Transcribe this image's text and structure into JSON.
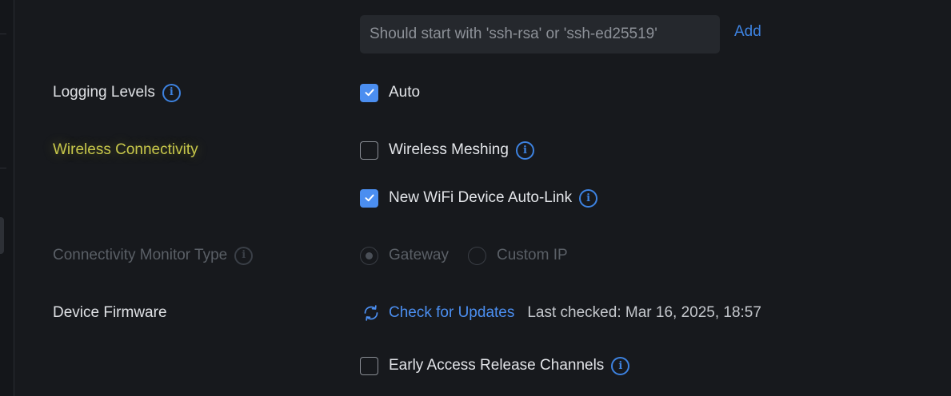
{
  "ssh_key": {
    "placeholder": "Should start with 'ssh-rsa' or 'ssh-ed25519'",
    "value": "",
    "add_label": "Add"
  },
  "logging": {
    "label": "Logging Levels",
    "auto_label": "Auto",
    "auto_checked": true
  },
  "wireless": {
    "label": "Wireless Connectivity",
    "meshing_label": "Wireless Meshing",
    "meshing_checked": false,
    "autolink_label": "New WiFi Device Auto-Link",
    "autolink_checked": true
  },
  "connectivity_monitor": {
    "label": "Connectivity Monitor Type",
    "options": [
      "Gateway",
      "Custom IP"
    ],
    "selected": "Gateway",
    "disabled": true
  },
  "firmware": {
    "label": "Device Firmware",
    "check_label": "Check for Updates",
    "last_checked": "Last checked: Mar 16, 2025, 18:57",
    "early_access_label": "Early Access Release Channels",
    "early_access_checked": false
  },
  "colors": {
    "accent": "#4b8ef0",
    "highlight": "#c7c74a",
    "background": "#17191d"
  },
  "icons": {
    "info": "info-icon",
    "check": "check-icon",
    "refresh": "refresh-icon"
  }
}
